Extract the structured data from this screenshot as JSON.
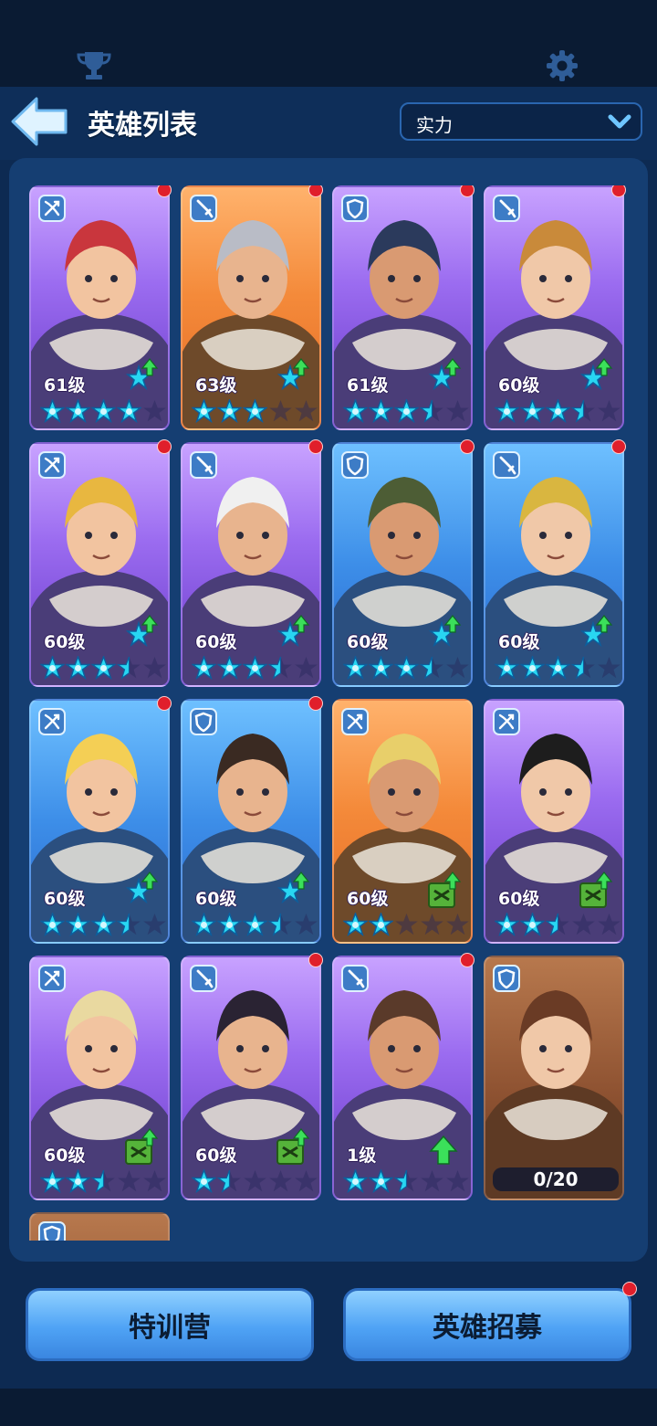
{
  "header": {
    "title": "英雄列表",
    "sort_label": "实力"
  },
  "heroes": [
    {
      "level": "61级",
      "theme": "purple",
      "role": "crossbow-icon",
      "stars": [
        1,
        1,
        1,
        1,
        0
      ],
      "upgrade": "star",
      "dot": true
    },
    {
      "level": "63级",
      "theme": "orange",
      "role": "sword-icon",
      "stars": [
        1,
        1,
        1,
        0,
        0
      ],
      "upgrade": "star",
      "dot": true
    },
    {
      "level": "61级",
      "theme": "purple",
      "role": "shield-icon",
      "stars": [
        1,
        1,
        1,
        0.5,
        0
      ],
      "upgrade": "star",
      "dot": true
    },
    {
      "level": "60级",
      "theme": "purple",
      "role": "sword-icon",
      "stars": [
        1,
        1,
        1,
        0.5,
        0
      ],
      "upgrade": "star",
      "dot": true
    },
    {
      "level": "60级",
      "theme": "purple",
      "role": "crossbow-icon",
      "stars": [
        1,
        1,
        1,
        0.5,
        0
      ],
      "upgrade": "star",
      "dot": true
    },
    {
      "level": "60级",
      "theme": "purple",
      "role": "sword-icon",
      "stars": [
        1,
        1,
        1,
        0.5,
        0
      ],
      "upgrade": "star",
      "dot": true
    },
    {
      "level": "60级",
      "theme": "blue",
      "role": "shield-icon",
      "stars": [
        1,
        1,
        1,
        0.5,
        0
      ],
      "upgrade": "star",
      "dot": true
    },
    {
      "level": "60级",
      "theme": "blue",
      "role": "sword-icon",
      "stars": [
        1,
        1,
        1,
        0.5,
        0
      ],
      "upgrade": "star",
      "dot": true
    },
    {
      "level": "60级",
      "theme": "blue",
      "role": "crossbow-icon",
      "stars": [
        1,
        1,
        1,
        0.5,
        0
      ],
      "upgrade": "star",
      "dot": true
    },
    {
      "level": "60级",
      "theme": "blue",
      "role": "shield-icon",
      "stars": [
        1,
        1,
        1,
        0.5,
        0
      ],
      "upgrade": "star",
      "dot": true
    },
    {
      "level": "60级",
      "theme": "orange",
      "role": "crossbow-icon",
      "stars": [
        1,
        1,
        0,
        0,
        0
      ],
      "upgrade": "book",
      "dot": false
    },
    {
      "level": "60级",
      "theme": "purple",
      "role": "crossbow-icon",
      "stars": [
        1,
        1,
        0.5,
        0,
        0
      ],
      "upgrade": "book",
      "dot": false
    },
    {
      "level": "60级",
      "theme": "purple",
      "role": "crossbow-icon",
      "stars": [
        1,
        1,
        0.5,
        0,
        0
      ],
      "upgrade": "book",
      "dot": false
    },
    {
      "level": "60级",
      "theme": "purple",
      "role": "sword-icon",
      "stars": [
        1,
        0.5,
        0,
        0,
        0
      ],
      "upgrade": "book",
      "dot": true
    },
    {
      "level": "1级",
      "theme": "purple",
      "role": "sword-icon",
      "stars": [
        1,
        1,
        0.5,
        0,
        0
      ],
      "upgrade": "arrow",
      "dot": true
    },
    {
      "level": "",
      "theme": "brown",
      "role": "shield-icon",
      "stars": [],
      "upgrade": "none",
      "dot": false,
      "progress": "0/20"
    }
  ],
  "partial_card": {
    "theme": "brown",
    "role": "shield-icon"
  },
  "buttons": {
    "training": "特训营",
    "recruit": "英雄招募"
  },
  "colors": {
    "accent_blue": "#4fa3f5",
    "notify_red": "#e01f2b",
    "star_cyan": "#28d6f2"
  }
}
